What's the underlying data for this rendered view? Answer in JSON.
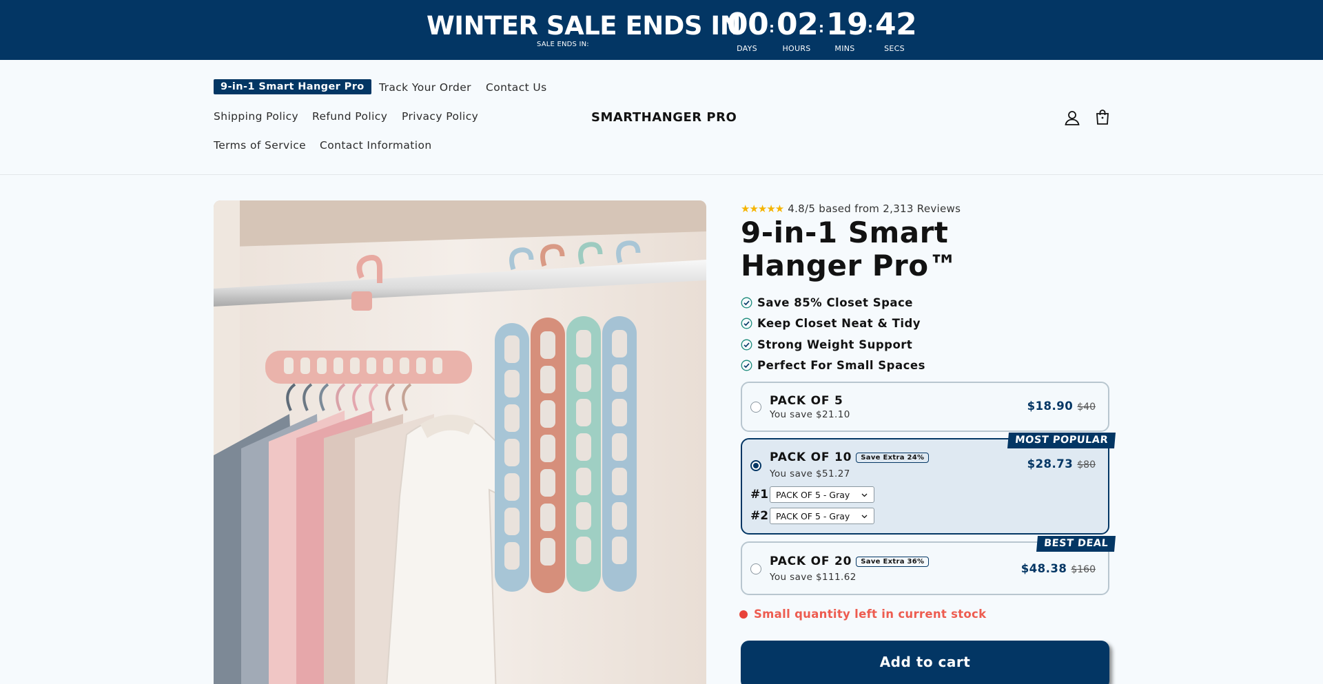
{
  "announcement": {
    "title": "WINTER SALE ENDS IN",
    "subtitle": "SALE ENDS IN:",
    "countdown": [
      {
        "value": "00",
        "label": "DAYS"
      },
      {
        "value": "02",
        "label": "HOURS"
      },
      {
        "value": "19",
        "label": "MINS"
      },
      {
        "value": "42",
        "label": "SECS"
      }
    ],
    "separator": ":"
  },
  "nav": {
    "links": [
      "9-in-1 Smart Hanger Pro",
      "Track Your Order",
      "Contact Us",
      "Shipping Policy",
      "Refund Policy",
      "Privacy Policy",
      "Terms of Service",
      "Contact Information"
    ],
    "active_index": 0
  },
  "brand": "SMARTHANGER PRO",
  "header_icons": [
    "account-icon",
    "cart-icon"
  ],
  "product": {
    "image_alt": "hangers-in-closet",
    "stars": "★★★★★",
    "rating_text": "4.8/5 based from 2,313 Reviews",
    "title": "9-in-1 Smart Hanger Pro™",
    "bullets": [
      "Save 85% Closet Space",
      "Keep Closet Neat & Tidy",
      "Strong Weight Support",
      "Perfect For Small Spaces"
    ],
    "packs": [
      {
        "name": "PACK OF 5",
        "save": "You save $21.10",
        "price": "$18.90",
        "was": "$40",
        "badge": "",
        "ribbon": "",
        "selected": false
      },
      {
        "name": "PACK OF 10",
        "save": "You save $51.27",
        "price": "$28.73",
        "was": "$80",
        "badge": "Save Extra 24%",
        "ribbon": "MOST POPULAR",
        "selected": true
      },
      {
        "name": "PACK OF 20",
        "save": "You save $111.62",
        "price": "$48.38",
        "was": "$160",
        "badge": "Save Extra 36%",
        "ribbon": "BEST DEAL",
        "selected": false
      }
    ],
    "variant_selects": [
      {
        "label": "#1",
        "value": "PACK OF 5 - Gray"
      },
      {
        "label": "#2",
        "value": "PACK OF 5 - Gray"
      }
    ],
    "stock_text": "Small quantity left in current stock",
    "add_to_cart": "Add to cart"
  },
  "colors": {
    "brand_navy": "#033664",
    "stock_red": "#ed5c50",
    "star_gold": "#f5b400"
  }
}
